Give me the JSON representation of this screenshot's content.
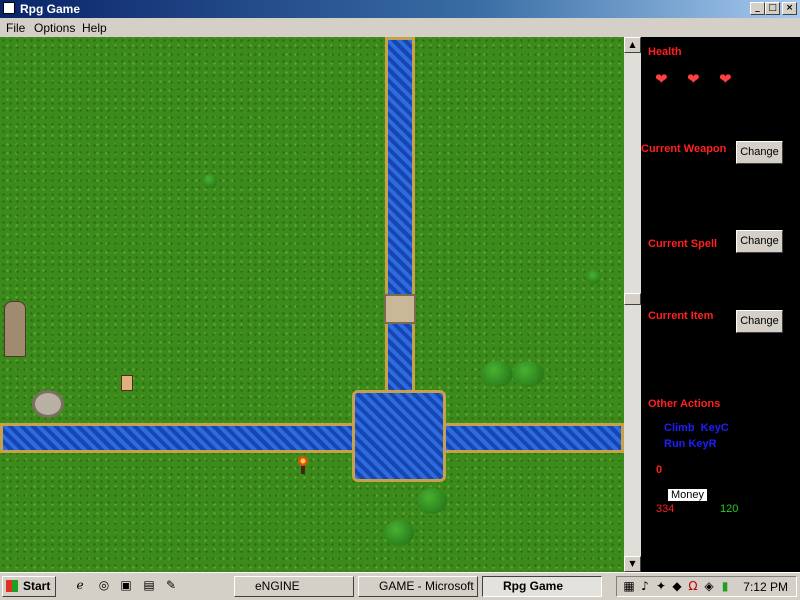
{
  "window": {
    "title": "Rpg Game",
    "min": "_",
    "max": "□",
    "close": "×"
  },
  "menu": [
    "File",
    "Options",
    "Help"
  ],
  "panel": {
    "health_label": "Health",
    "hearts": [
      "❤",
      "❤",
      "❤"
    ],
    "weapon_label": "Current Weapon",
    "spell_label": "Current Spell",
    "item_label": "Current Item",
    "change_label": "Change",
    "other_actions_label": "Other Actions",
    "actions": [
      "Climb  KeyC",
      "Run KeyR"
    ],
    "counter": "0",
    "money_label": "Money",
    "money_left": "334",
    "money_right": "120"
  },
  "taskbar": {
    "start": "Start",
    "tasks": [
      "eNGINE",
      "GAME - Microsoft ...",
      "Rpg Game"
    ],
    "clock": "7:12 PM"
  }
}
